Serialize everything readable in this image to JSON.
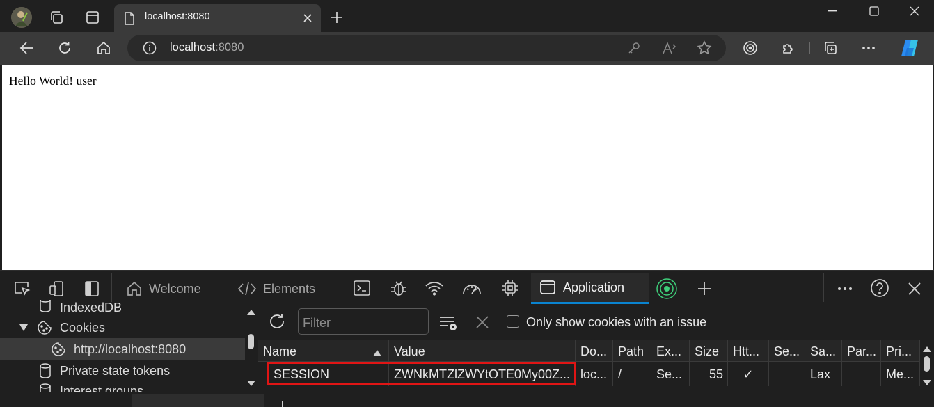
{
  "browser": {
    "tab_title": "localhost:8080",
    "url_host": "localhost",
    "url_port": ":8080"
  },
  "page": {
    "body_text": "Hello World! user"
  },
  "devtools": {
    "tabs": [
      {
        "label": "Welcome"
      },
      {
        "label": "Elements"
      },
      {
        "label": "Application"
      }
    ],
    "sidebar": {
      "items": [
        {
          "label": "IndexedDB"
        },
        {
          "label": "Cookies"
        },
        {
          "label": "http://localhost:8080"
        },
        {
          "label": "Private state tokens"
        },
        {
          "label": "Interest groups"
        }
      ]
    },
    "cookies": {
      "filter_placeholder": "Filter",
      "only_issue_label": "Only show cookies with an issue",
      "columns": [
        "Name",
        "Value",
        "Do...",
        "Path",
        "Ex...",
        "Size",
        "Htt...",
        "Se...",
        "Sa...",
        "Par...",
        "Pri..."
      ],
      "rows": [
        {
          "name": "SESSION",
          "value": "ZWNkMTZlZWYtOTE0My00Z...",
          "domain": "loc...",
          "path": "/",
          "expires": "Se...",
          "size": "55",
          "httponly": "✓",
          "secure": "",
          "samesite": "Lax",
          "partition": "",
          "priority": "Me..."
        }
      ]
    }
  },
  "colors": {
    "accent": "#0a84d0",
    "highlight_border": "#e01515"
  }
}
